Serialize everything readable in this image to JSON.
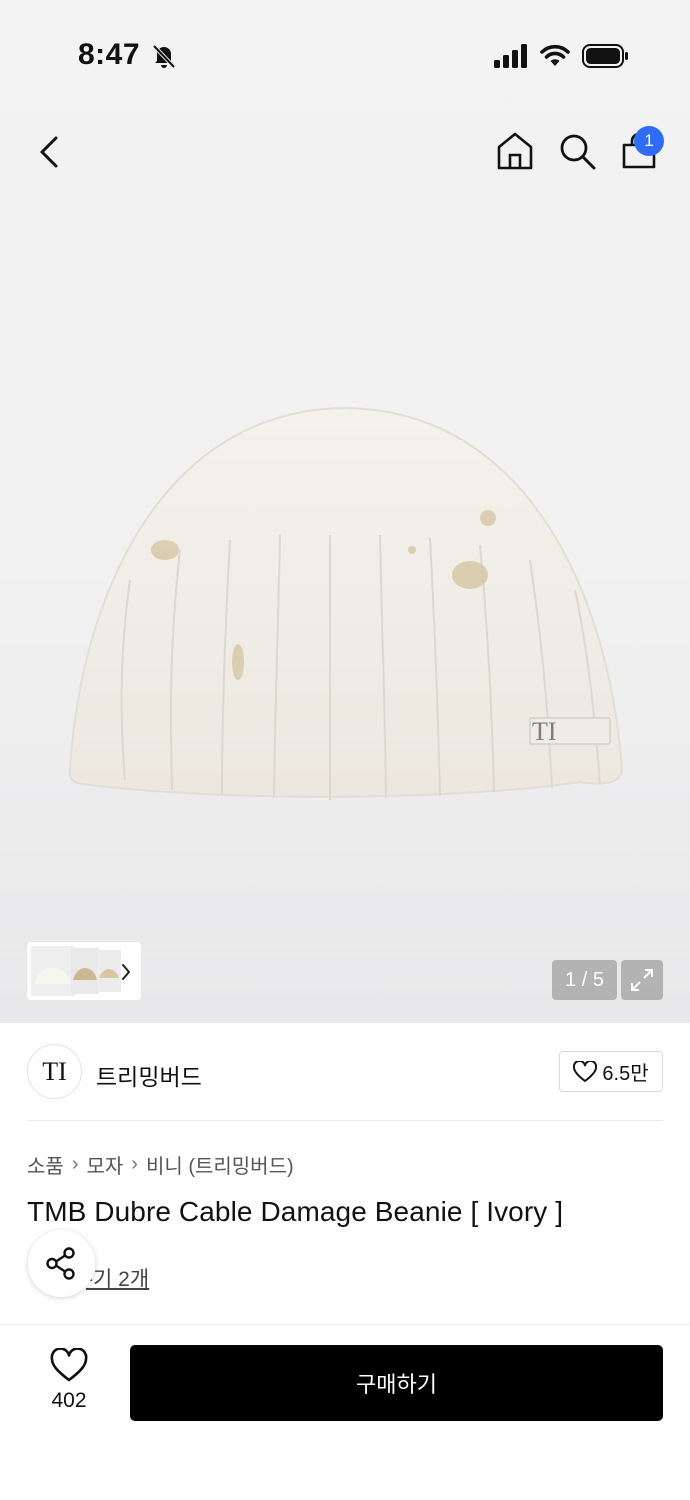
{
  "status_bar": {
    "time": "8:47"
  },
  "nav": {
    "cart_count": "1"
  },
  "gallery": {
    "pager": "1 / 5"
  },
  "brand": {
    "logo_text": "TI",
    "name": "트리밍버드",
    "likes": "6.5만"
  },
  "breadcrumb": {
    "items": [
      "소품",
      "모자",
      "비니 (트리밍버드)"
    ]
  },
  "product": {
    "title": "TMB Dubre Cable Damage Beanie [ Ivory ]",
    "review_link": "후기 2개",
    "review_visible": "-기 2개"
  },
  "bottom_bar": {
    "wish_count": "402",
    "buy_label": "구매하기"
  },
  "colors": {
    "badge": "#2f6cf6",
    "buy_button": "#000000",
    "hero_bg": "#f2f2f2"
  },
  "icons": [
    "bell-off-icon",
    "signal-icon",
    "wifi-icon",
    "battery-icon",
    "back-icon",
    "home-icon",
    "search-icon",
    "cart-icon",
    "expand-icon",
    "heart-icon",
    "share-icon",
    "chevron-right-icon"
  ]
}
